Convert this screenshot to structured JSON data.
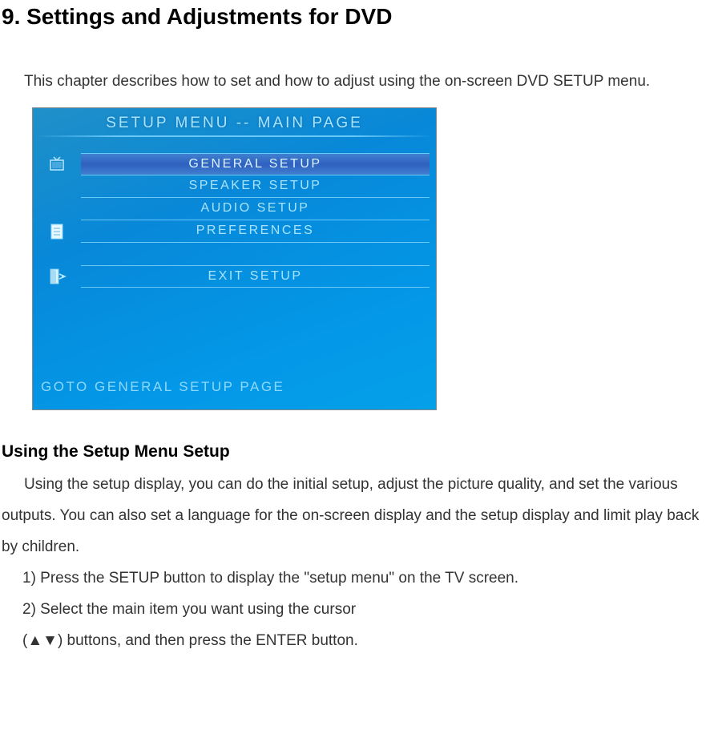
{
  "title": "9. Settings and Adjustments for DVD",
  "intro": "This chapter describes how to set and how to adjust using the on-screen DVD SETUP menu.",
  "screen": {
    "header": "SETUP MENU -- MAIN PAGE",
    "items": [
      {
        "label": "GENERAL SETUP",
        "selected": true
      },
      {
        "label": "SPEAKER SETUP",
        "selected": false
      },
      {
        "label": "AUDIO SETUP",
        "selected": false
      },
      {
        "label": "PREFERENCES",
        "selected": false
      }
    ],
    "exit": {
      "label": "EXIT SETUP"
    },
    "hint": "GOTO GENERAL SETUP PAGE"
  },
  "subheading": "Using the Setup Menu Setup",
  "body": "Using the setup display, you can do the initial setup, adjust the picture quality, and set the various outputs. You can also set a language for the on-screen display and the setup display and limit play back by children.",
  "steps": {
    "s1": "1) Press the SETUP button to display the \"setup menu\" on the TV screen.",
    "s2": "2) Select the main item you want using the cursor",
    "s3": "(▲▼) buttons, and then press the ENTER button."
  }
}
